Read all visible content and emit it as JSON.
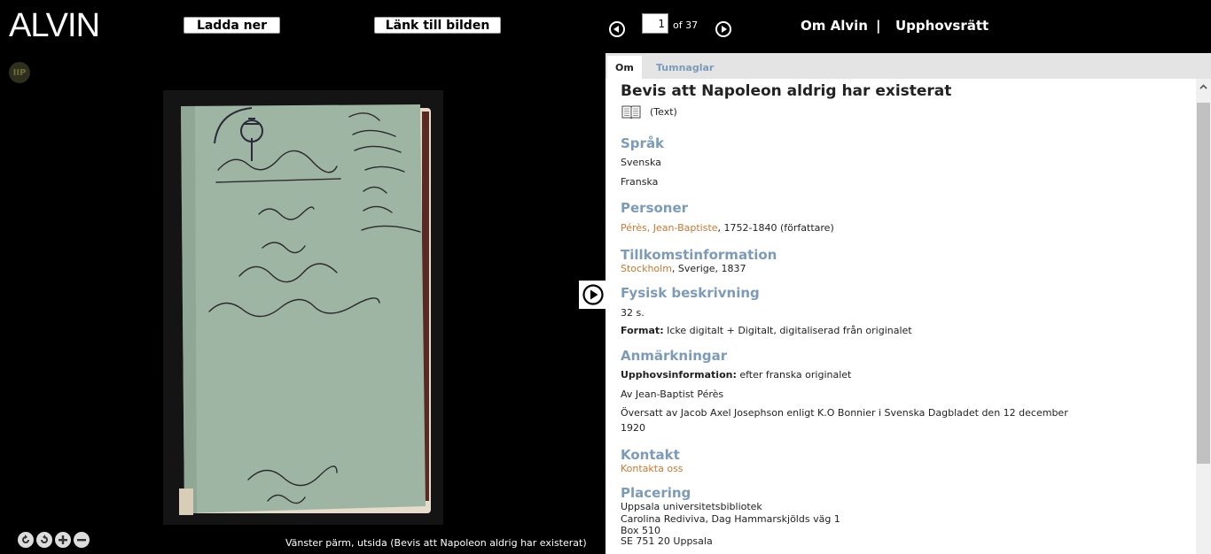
{
  "header": {
    "logo": "ALVIN",
    "download_label": "Ladda ner",
    "link_label": "Länk till bilden",
    "page_current": "1",
    "page_of": "of 37",
    "about_link": "Om Alvin",
    "separator": "|",
    "copyright_link": "Upphovsrätt"
  },
  "viewer": {
    "iip_label": "IIP",
    "caption": "Vänster pärm, utsida (Bevis att Napoleon aldrig har existerat)",
    "controls": [
      "rotate-left-icon",
      "rotate-right-icon",
      "zoom-in-icon",
      "zoom-out-icon"
    ]
  },
  "tabs": [
    {
      "label": "Om"
    },
    {
      "label": "Tumnaglar"
    }
  ],
  "record": {
    "title": "Bevis att Napoleon aldrig har existerat",
    "type": "(Text)",
    "sections": {
      "language": {
        "heading": "Språk",
        "values": [
          "Svenska",
          "Franska"
        ]
      },
      "persons": {
        "heading": "Personer",
        "name_link": "Pérès, Jean-Baptiste",
        "details": ", 1752-1840 (författare)"
      },
      "origin": {
        "heading": "Tillkomstinformation",
        "place_link": "Stockholm",
        "details": ", Sverige, 1837"
      },
      "physical": {
        "heading": "Fysisk beskrivning",
        "extent": "32 s.",
        "format_label": "Format:",
        "format_value": " Icke digitalt + Digitalt, digitaliserad från originalet"
      },
      "notes": {
        "heading": "Anmärkningar",
        "responsibility_label": "Upphovsinformation:",
        "responsibility_value": " efter franska originalet",
        "author_note": "Av Jean-Baptist Pérès",
        "translation_line1": "Översatt av Jacob Axel Josephson enligt K.O Bonnier i Svenska Dagbladet den 12 december",
        "translation_line2": "1920"
      },
      "contact": {
        "heading": "Kontakt",
        "link": "Kontakta oss"
      },
      "location": {
        "heading": "Placering",
        "lines": [
          "Uppsala universitetsbibliotek",
          "Carolina Rediviva, Dag Hammarskjölds väg 1",
          "Box 510",
          "SE 751 20 Uppsala"
        ]
      }
    }
  },
  "colors": {
    "heading": "#7d9bb7",
    "link": "#c87830",
    "book_cover": "#9fb5a4",
    "background": "#000000"
  }
}
